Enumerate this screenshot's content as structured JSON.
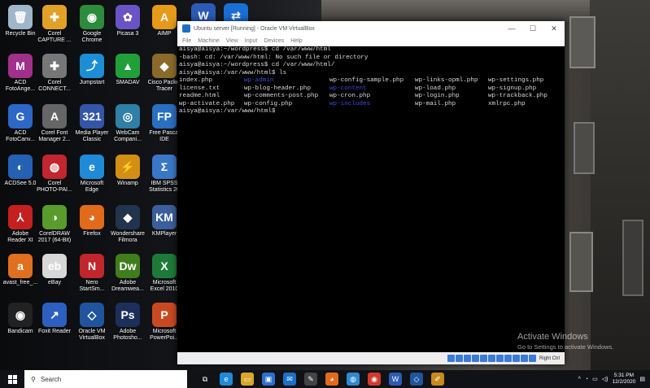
{
  "desktop": {
    "icons": [
      {
        "name": "recycle-bin",
        "label": "Recycle Bin",
        "glyph": "🗑",
        "color": "#9fb7c9"
      },
      {
        "name": "corel-capture",
        "label": "Corel CAPTURE ...",
        "glyph": "✚",
        "color": "#e0a126"
      },
      {
        "name": "google-chrome",
        "label": "Google Chrome",
        "glyph": "◉",
        "color": "#2c8c3c"
      },
      {
        "name": "picasa",
        "label": "Picasa 3",
        "glyph": "✿",
        "color": "#6a53c6"
      },
      {
        "name": "aimp",
        "label": "AIMP",
        "glyph": "A",
        "color": "#e69a1a"
      },
      {
        "name": "acd-fotoangelo",
        "label": "ACD FotoAnge...",
        "glyph": "M",
        "color": "#a1308d"
      },
      {
        "name": "corel-connect",
        "label": "Corel CONNECT...",
        "glyph": "✚",
        "color": "#777"
      },
      {
        "name": "jumpstart",
        "label": "Jumpstart",
        "glyph": "⤴",
        "color": "#1b8ed6"
      },
      {
        "name": "smadav",
        "label": "SMADAV",
        "glyph": "▲",
        "color": "#21a03a"
      },
      {
        "name": "cisco-packet-tracer",
        "label": "Cisco Packet Tracer",
        "glyph": "◆",
        "color": "#8a6a2a"
      },
      {
        "name": "acd-fotocanvas",
        "label": "ACD FotoCanv...",
        "glyph": "G",
        "color": "#2d67c7"
      },
      {
        "name": "corel-font-manager",
        "label": "Corel Font Manager 2...",
        "glyph": "A",
        "color": "#666"
      },
      {
        "name": "media-player-classic",
        "label": "Media Player Classic",
        "glyph": "321",
        "color": "#3456a8"
      },
      {
        "name": "webcam-companion",
        "label": "WebCam Compani...",
        "glyph": "◎",
        "color": "#2f7fa6"
      },
      {
        "name": "free-pascal-ide",
        "label": "Free Pascal IDE",
        "glyph": "FP",
        "color": "#2a6fc0"
      },
      {
        "name": "acdsee",
        "label": "ACDSee 5.0",
        "glyph": "◐",
        "color": "#2561b3"
      },
      {
        "name": "corel-photo-paint",
        "label": "Corel PHOTO-PAI...",
        "glyph": "◍",
        "color": "#c2262e"
      },
      {
        "name": "microsoft-edge",
        "label": "Microsoft Edge",
        "glyph": "e",
        "color": "#1f8ad8"
      },
      {
        "name": "winamp",
        "label": "Winamp",
        "glyph": "⚡",
        "color": "#d28f14"
      },
      {
        "name": "ibm-spss",
        "label": "IBM SPSS Statistics 20",
        "glyph": "Σ",
        "color": "#3a77c8"
      },
      {
        "name": "adobe-reader",
        "label": "Adobe Reader XI",
        "glyph": "⅄",
        "color": "#c4201f"
      },
      {
        "name": "coreldraw",
        "label": "CorelDRAW 2017 (64-Bit)",
        "glyph": "◑",
        "color": "#5a9b2d"
      },
      {
        "name": "firefox",
        "label": "Firefox",
        "glyph": "◕",
        "color": "#e26a1a"
      },
      {
        "name": "wondershare-filmora",
        "label": "Wondershare Filmora",
        "glyph": "◆",
        "color": "#22334d"
      },
      {
        "name": "kmplayer",
        "label": "KMPlayer",
        "glyph": "KM",
        "color": "#3a5f9c"
      },
      {
        "name": "avast",
        "label": "avast_free_...",
        "glyph": "a",
        "color": "#e07020"
      },
      {
        "name": "ebay",
        "label": "eBay",
        "glyph": "eb",
        "color": "#d8d8d8"
      },
      {
        "name": "nero-startsmart",
        "label": "Nero StartSm...",
        "glyph": "N",
        "color": "#c0262b"
      },
      {
        "name": "adobe-dreamweaver",
        "label": "Adobe Dreamwea...",
        "glyph": "Dw",
        "color": "#3f7d1d"
      },
      {
        "name": "microsoft-excel",
        "label": "Microsoft Excel 2010",
        "glyph": "X",
        "color": "#1f7a3a"
      },
      {
        "name": "bandicam",
        "label": "Bandicam",
        "glyph": "◉",
        "color": "#222"
      },
      {
        "name": "foxit-reader",
        "label": "Foxit Reader",
        "glyph": "↗",
        "color": "#2c5fbf"
      },
      {
        "name": "oracle-vm-virtualbox",
        "label": "Oracle VM VirtualBox",
        "glyph": "◇",
        "color": "#20549c"
      },
      {
        "name": "adobe-photoshop",
        "label": "Adobe Photosho...",
        "glyph": "Ps",
        "color": "#1c2f5a"
      },
      {
        "name": "microsoft-powerpoint",
        "label": "Microsoft PowerPoi...",
        "glyph": "P",
        "color": "#c94a22"
      },
      {
        "name": "microsoft-word",
        "label": "",
        "glyph": "W",
        "color": "#2b5bb5"
      },
      {
        "name": "teamviewer",
        "label": "",
        "glyph": "⇄",
        "color": "#1a6fd6"
      }
    ]
  },
  "vbox": {
    "title": "Ubuntu server [Running] - Oracle VM VirtualBox",
    "minimize": "—",
    "maximize": "☐",
    "close": "✕",
    "menu": [
      "File",
      "Machine",
      "View",
      "Input",
      "Devices",
      "Help"
    ],
    "hostkey": "Right Ctrl"
  },
  "terminal": {
    "lines": [
      "aisya@aisya:~/wordpress$ cd /var/www/html",
      "-bash: cd: /var/www/html: No such file or directory",
      "aisya@aisya:~/wordpress$ cd /var/www/html/",
      "aisya@aisya:/var/www/html$ ls"
    ],
    "listing": [
      [
        {
          "t": "index.php"
        },
        {
          "t": "wp-admin",
          "dir": true
        },
        {
          "t": "wp-config-sample.php"
        },
        {
          "t": "wp-links-opml.php"
        },
        {
          "t": "wp-settings.php"
        }
      ],
      [
        {
          "t": "license.txt"
        },
        {
          "t": "wp-blog-header.php"
        },
        {
          "t": "wp-content",
          "dir": true
        },
        {
          "t": "wp-load.php"
        },
        {
          "t": "wp-signup.php"
        }
      ],
      [
        {
          "t": "readme.html"
        },
        {
          "t": "wp-comments-post.php"
        },
        {
          "t": "wp-cron.php"
        },
        {
          "t": "wp-login.php"
        },
        {
          "t": "wp-trackback.php"
        }
      ],
      [
        {
          "t": "wp-activate.php"
        },
        {
          "t": "wp-config.php"
        },
        {
          "t": "wp-includes",
          "dir": true
        },
        {
          "t": "wp-mail.php"
        },
        {
          "t": "xmlrpc.php"
        }
      ]
    ],
    "prompt": "aisya@aisya:/var/www/html$"
  },
  "watermark": {
    "title": "Activate Windows",
    "subtitle": "Go to Settings to activate Windows."
  },
  "taskbar": {
    "search_placeholder": "Search",
    "apps": [
      {
        "name": "task-view",
        "glyph": "⧉",
        "color": "#101216"
      },
      {
        "name": "edge",
        "glyph": "e",
        "color": "#1f8ad8"
      },
      {
        "name": "file-explorer",
        "glyph": "▭",
        "color": "#d8a72a"
      },
      {
        "name": "store",
        "glyph": "▣",
        "color": "#2b6fd1"
      },
      {
        "name": "mail",
        "glyph": "✉",
        "color": "#1c70c9"
      },
      {
        "name": "pen",
        "glyph": "✎",
        "color": "#444"
      },
      {
        "name": "firefox",
        "glyph": "◕",
        "color": "#e26a1a"
      },
      {
        "name": "globe",
        "glyph": "◍",
        "color": "#2e8ad0"
      },
      {
        "name": "chrome",
        "glyph": "◉",
        "color": "#d23b2b"
      },
      {
        "name": "word",
        "glyph": "W",
        "color": "#2b5bb5"
      },
      {
        "name": "virtualbox",
        "glyph": "◇",
        "color": "#20549c"
      },
      {
        "name": "paint",
        "glyph": "✐",
        "color": "#c98a1c"
      }
    ],
    "time": "5:31 PM",
    "date": "12/2/2020"
  }
}
